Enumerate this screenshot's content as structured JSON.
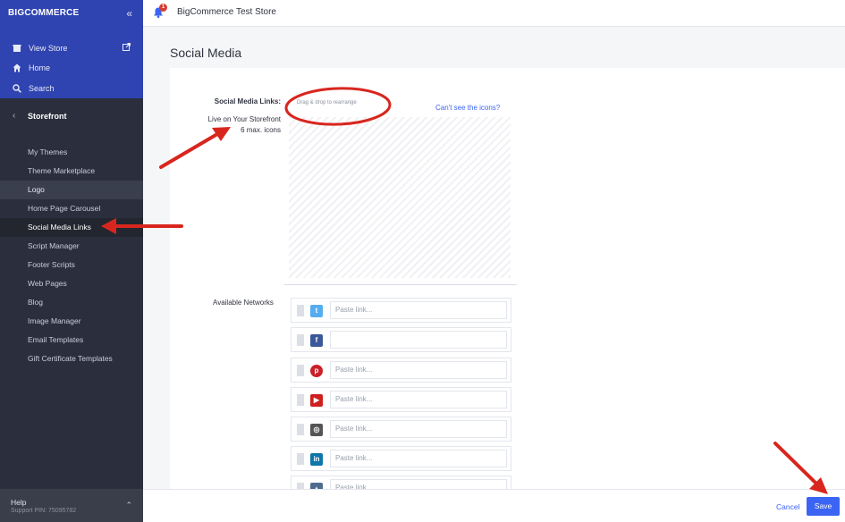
{
  "app": {
    "logo_text": "BIGCOMMERCE",
    "store_name": "BigCommerce Test Store",
    "notification_count": "1"
  },
  "sidebar": {
    "top_links": [
      {
        "label": "View Store",
        "icon": "store-icon"
      },
      {
        "label": "Home",
        "icon": "home-icon"
      },
      {
        "label": "Search",
        "icon": "search-icon"
      }
    ],
    "section_title": "Storefront",
    "items": [
      {
        "label": "My Themes"
      },
      {
        "label": "Theme Marketplace"
      },
      {
        "label": "Logo"
      },
      {
        "label": "Home Page Carousel"
      },
      {
        "label": "Social Media Links"
      },
      {
        "label": "Script Manager"
      },
      {
        "label": "Footer Scripts"
      },
      {
        "label": "Web Pages"
      },
      {
        "label": "Blog"
      },
      {
        "label": "Image Manager"
      },
      {
        "label": "Email Templates"
      },
      {
        "label": "Gift Certificate Templates"
      }
    ],
    "help_label": "Help",
    "support_pin": "Support PIN: 75095782"
  },
  "page": {
    "title": "Social Media",
    "links_label": "Social Media Links:",
    "live_label": "Live on Your Storefront",
    "max_label": "6 max. icons",
    "drag_hint": "Drag & drop to rearrange",
    "cant_see": "Can't see the icons?",
    "available_label": "Available Networks"
  },
  "networks": [
    {
      "icon": "twitter-icon",
      "glyph": "t",
      "color": "#55acee",
      "placeholder": "Paste link...",
      "value": ""
    },
    {
      "icon": "facebook-icon",
      "glyph": "f",
      "color": "#3b5998",
      "placeholder": "",
      "value": ""
    },
    {
      "icon": "pinterest-icon",
      "glyph": "p",
      "color": "#cb2027",
      "placeholder": "Paste link...",
      "value": ""
    },
    {
      "icon": "youtube-icon",
      "glyph": "▶",
      "color": "#cd201f",
      "placeholder": "Paste link...",
      "value": ""
    },
    {
      "icon": "instagram-icon",
      "glyph": "◎",
      "color": "#555555",
      "placeholder": "Paste link...",
      "value": ""
    },
    {
      "icon": "linkedin-icon",
      "glyph": "in",
      "color": "#0e76a8",
      "placeholder": "Paste link...",
      "value": ""
    },
    {
      "icon": "tumblr-icon",
      "glyph": "▲",
      "color": "#4f6a8f",
      "placeholder": "Paste link...",
      "value": ""
    }
  ],
  "footer": {
    "cancel_label": "Cancel",
    "save_label": "Save"
  }
}
